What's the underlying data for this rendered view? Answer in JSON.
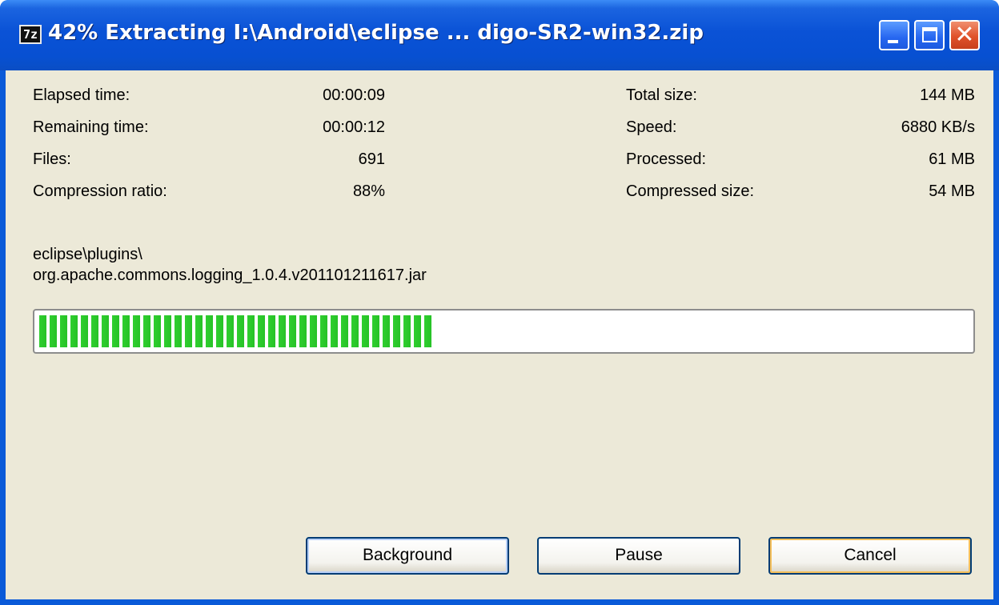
{
  "window": {
    "title": "42% Extracting I:\\Android\\eclipse ... digo-SR2-win32.zip",
    "app_icon_text": "7z",
    "controls": {
      "minimize_icon": "minimize-icon",
      "maximize_icon": "maximize-icon",
      "close_icon": "close-icon",
      "close_glyph": "✕"
    }
  },
  "stats_left": [
    {
      "label": "Elapsed time:",
      "value": "00:00:09"
    },
    {
      "label": "Remaining time:",
      "value": "00:00:12"
    },
    {
      "label": "Files:",
      "value": "691"
    },
    {
      "label": "Compression ratio:",
      "value": "88%"
    }
  ],
  "stats_right": [
    {
      "label": "Total size:",
      "value": "144 MB"
    },
    {
      "label": "Speed:",
      "value": "6880 KB/s"
    },
    {
      "label": "Processed:",
      "value": "61 MB"
    },
    {
      "label": "Compressed size:",
      "value": "54 MB"
    }
  ],
  "current_file": {
    "folder": "eclipse\\plugins\\",
    "name": "org.apache.commons.logging_1.0.4.v201101211617.jar"
  },
  "progress": {
    "fraction": 0.42,
    "fill_color": "#2fcf2f"
  },
  "buttons": {
    "background": "Background",
    "pause": "Pause",
    "cancel": "Cancel"
  },
  "colors": {
    "titlebar": "#0a52d6",
    "dialog_bg": "#ece9d8",
    "close_button": "#e0522a"
  }
}
